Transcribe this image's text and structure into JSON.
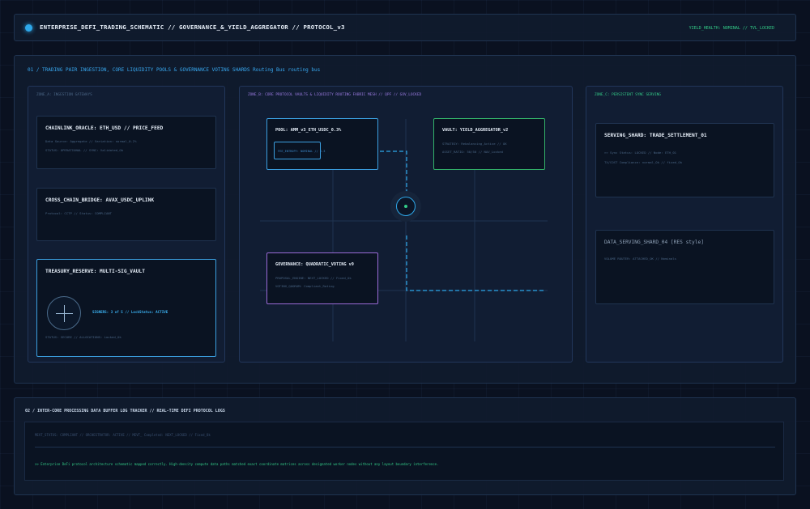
{
  "header": {
    "title": "ENTERPRISE_DEFI_TRADING_SCHEMATIC // GOVERNANCE_&_YIELD_AGGREGATOR // PROTOCOL_v3",
    "status": "YIELD_HEALTH: NOMINAL // TVL_LOCKED"
  },
  "main": {
    "title": "01 / TRADING PAIR INGESTION, CORE LIQUIDITY POOLS & GOVERNANCE VOTING SHARDS Routing Bus routing bus",
    "zone_a": {
      "label": "ZONE_A: INGESTION GATEWAYS",
      "oracle": {
        "title": "CHAINLINK_ORACLE: ETH_USD // PRICE_FEED",
        "line1": "Data Source: Aggregate // Variation: normal_0.2%",
        "line2": "STATUS: OPERATIONAL // SYNC: Validated_Ok"
      },
      "bridge": {
        "title": "CROSS_CHAIN_BRIDGE: AVAX_USDC_UPLINK",
        "line1": "Protocol: CCTP // Status: COMPLIANT"
      },
      "treasury": {
        "title": "TREASURY_RESERVE: MULTI-SIG_VAULT",
        "signers": "SIGNERS: 3 of 5 // LockStatus: ACTIVE",
        "status": "STATUS: SECURE // ALLOCATIONS: Locked_Ok"
      }
    },
    "zone_b": {
      "label": "ZONE_B: CORE PROTOCOL VAULTS & LIQUIDITY ROUTING FABRIC MESH // QPF // GOV_LOCKED",
      "pool": {
        "title": "POOL: AMM_v3_ETH_USDC_0.3%",
        "tag": "FEE_ENTROPY: NOMINAL // 0.3"
      },
      "vault": {
        "title": "VAULT: YIELD_AGGREGATOR_v2",
        "line1": "STRATEGY: Rebalancing_Active // OK",
        "line2": "ASSET_RATIO: 50/50 // NAV_Locked"
      },
      "gov": {
        "title": "GOVERNANCE: QUADRATIC_VOTING v9",
        "line1": "PROPOSAL_ENGINE: NEXT_LOCKED // Fixed_Ok",
        "line2": "VOTING_QUORUM: Compliant_Rating"
      }
    },
    "zone_c": {
      "label": "ZONE_C: PERSISTENT SYNC SERVING",
      "settle": {
        "title": "SERVING_SHARD: TRADE_SETTLEMENT_01",
        "line1": ">> Sync Status: LOCKED // Node: ETH_01",
        "line2": "TX/COST Compliance: normal_Ok // fixed_Ok"
      },
      "dss": {
        "title": "DATA_SERVING_SHARD_04 [RES style]",
        "line1": "VOLUME ROUTER: ATTACHED_OK // Nominals"
      }
    }
  },
  "log": {
    "title": "02 / INTER-CORE PROCESSING DATA BUFFER LOG TRACKER // REAL-TIME DEFI PROTOCOL LOGS",
    "line1": "MEVT_STATUS: COMPLIANT // ORCHESTRATOR: ACTIVE // MEVT_ Completed: NEXT_LOCKED // Fixed_Ok",
    "line2": ">> Enterprise DeFi protocol architecture schematic mapped correctly. High-density compute data paths matched exact coordinate matrices across designated worker nodes without any layout boundary interference."
  },
  "colors": {
    "accent_blue": "#2ea8ea",
    "accent_green": "#33cc88",
    "accent_purple": "#9a6ad6",
    "text_primary": "#e3ebf5"
  }
}
